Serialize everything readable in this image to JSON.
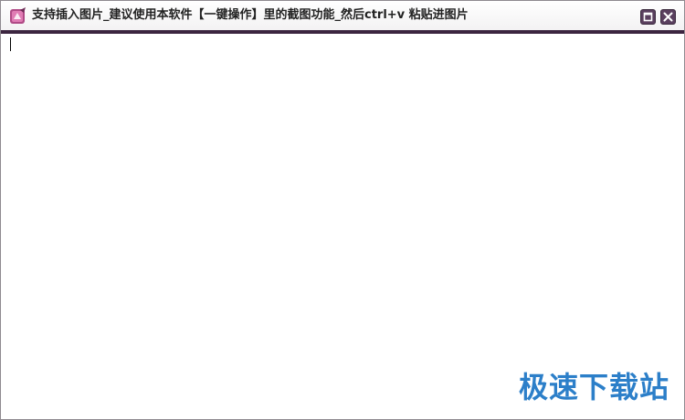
{
  "window": {
    "title": "支持插入图片_建议使用本软件【一键操作】里的截图功能_然后ctrl+v 粘贴进图片",
    "icon": "app-icon",
    "accent_color": "#3c2540",
    "button_color": "#5a3f5e"
  },
  "controls": {
    "maximize_icon": "maximize-icon",
    "close_icon": "close-icon"
  },
  "editor": {
    "content": ""
  },
  "watermark": {
    "text": "极速下载站",
    "color": "#2c7fc9"
  }
}
